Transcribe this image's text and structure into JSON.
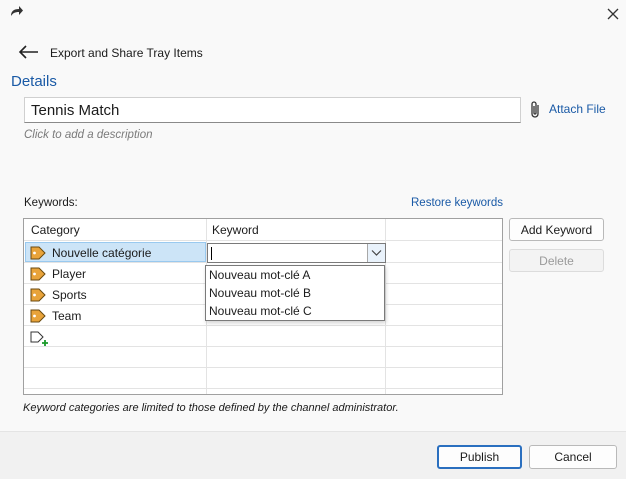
{
  "window": {
    "close_icon": "close-icon",
    "app_icon": "share-arrow-icon"
  },
  "header": {
    "title": "Export and Share Tray Items",
    "back_icon": "back-arrow-icon"
  },
  "details": {
    "section_title": "Details",
    "title_value": "Tennis Match",
    "attach_label": "Attach File",
    "description_placeholder": "Click to add a description"
  },
  "keywords": {
    "label": "Keywords:",
    "restore_label": "Restore keywords",
    "columns": [
      "Category",
      "Keyword"
    ],
    "categories": [
      {
        "label": "Nouvelle catégorie",
        "selected": true
      },
      {
        "label": "Player"
      },
      {
        "label": "Sports"
      },
      {
        "label": "Team"
      }
    ],
    "keyword_input_value": "",
    "dropdown_options": [
      "Nouveau mot-clé A",
      "Nouveau mot-clé B",
      "Nouveau mot-clé C"
    ],
    "add_keyword_label": "Add Keyword",
    "delete_label": "Delete",
    "footnote": "Keyword categories are limited to those defined by the channel administrator."
  },
  "footer": {
    "publish_label": "Publish",
    "cancel_label": "Cancel"
  },
  "colors": {
    "accent": "#1a5aa6",
    "tag": "#e8a33a",
    "selection": "#cce4f7"
  }
}
